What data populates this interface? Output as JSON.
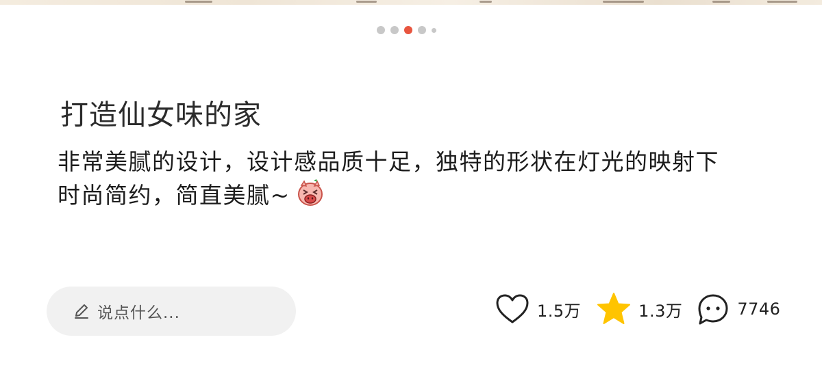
{
  "pager": {
    "total": 5,
    "active_index": 2
  },
  "post": {
    "title": "打造仙女味的家",
    "description": "非常美腻的设计，设计感品质十足，独特的形状在灯光的映射下时尚简约，简直美腻~",
    "emoji": "pig-laughing-emoji"
  },
  "comment_box": {
    "placeholder": "说点什么...",
    "icon": "pencil-icon"
  },
  "actions": {
    "like": {
      "icon": "heart-icon",
      "count": "1.5万"
    },
    "favorite": {
      "icon": "star-icon",
      "count": "1.3万",
      "color": "#ffc400"
    },
    "comment": {
      "icon": "chat-bubble-icon",
      "count": "7746"
    }
  },
  "colors": {
    "active_dot": "#e8553f",
    "inactive_dot": "#c8c8c8",
    "comment_box_bg": "#f1f1f1"
  }
}
